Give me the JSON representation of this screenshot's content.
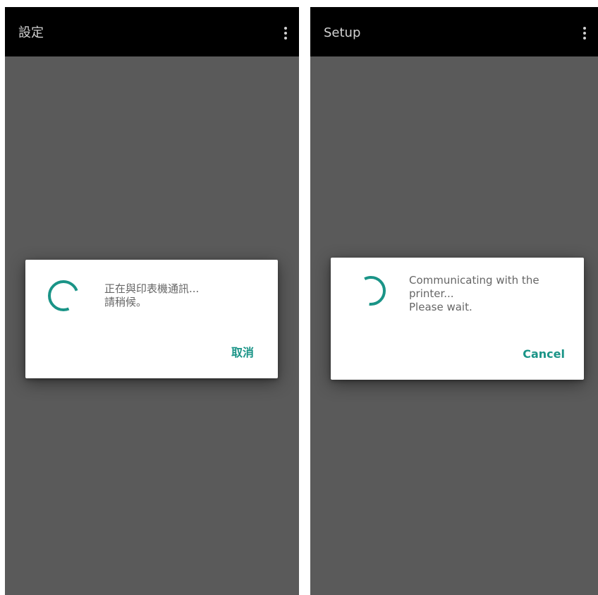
{
  "colors": {
    "accent": "#1a9487",
    "overlay": "#5a5a5a",
    "app_bar": "#000000",
    "dialog_bg": "#ffffff",
    "message_text": "#666666"
  },
  "icons": {
    "overflow_menu": "more-vert-icon",
    "progress": "spinner-icon"
  },
  "screens": [
    {
      "app_bar": {
        "title": "設定"
      },
      "dialog": {
        "message_lines": [
          "正在與印表機通訊...",
          "請稍候。"
        ],
        "cancel_label": "取消"
      }
    },
    {
      "app_bar": {
        "title": "Setup"
      },
      "dialog": {
        "message_lines": [
          "Communicating with the",
          "printer...",
          "Please wait."
        ],
        "cancel_label": "Cancel"
      }
    }
  ]
}
